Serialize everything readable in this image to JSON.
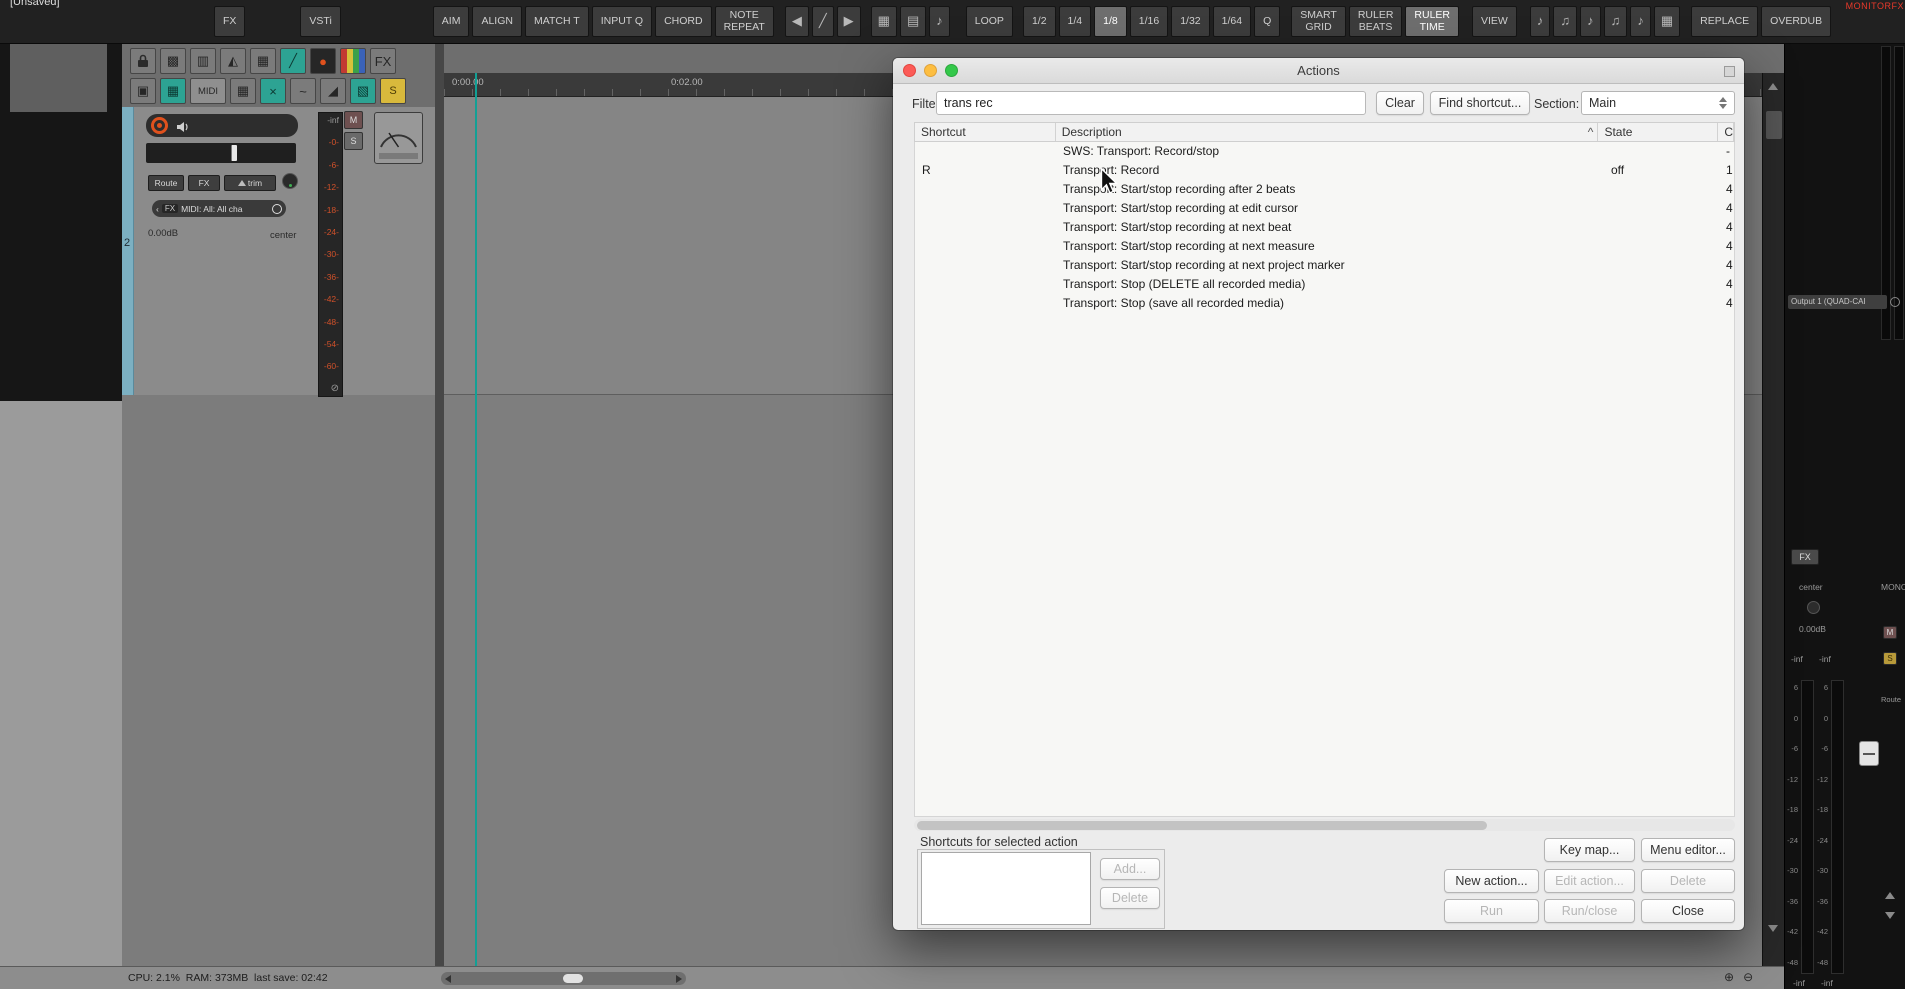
{
  "app": {
    "unsaved": "[Unsaved]",
    "monitor_fx": "MONITORFX",
    "status": "CPU: 2.1%  RAM: 373MB  last save: 02:42"
  },
  "toolbar": {
    "fx": "FX",
    "vsti": "VSTi",
    "actions": [
      "AIM",
      "ALIGN",
      "MATCH T",
      "INPUT Q",
      "CHORD",
      "NOTE\nREPEAT"
    ],
    "loop": "LOOP",
    "divisions": [
      {
        "label": "1/2"
      },
      {
        "label": "1/4"
      },
      {
        "label": "1/8",
        "active": true
      },
      {
        "label": "1/16"
      },
      {
        "label": "1/32"
      },
      {
        "label": "1/64"
      }
    ],
    "quantize": "Q",
    "ruler_modes": [
      {
        "label": "SMART\nGRID"
      },
      {
        "label": "RULER\nBEATS"
      },
      {
        "label": "RULER\nTIME",
        "active": true
      }
    ],
    "view": "VIEW",
    "replace": "REPLACE",
    "overdub": "OVERDUB"
  },
  "icons": {
    "transport": [
      {
        "name": "prev-marker-icon",
        "glyph": "◀"
      },
      {
        "name": "pencil-edit-icon",
        "glyph": "╱"
      },
      {
        "name": "play-icon",
        "glyph": "▶"
      }
    ],
    "grid_toggles": [
      {
        "name": "grid-lines-icon",
        "glyph": "▦"
      },
      {
        "name": "grid-frame-icon",
        "glyph": "▤"
      },
      {
        "name": "note-source-icon",
        "glyph": "♪"
      }
    ],
    "midi_tools": [
      {
        "name": "midi-tool-icon",
        "glyph": "♪"
      },
      {
        "name": "midi-tool-icon",
        "glyph": "♫"
      },
      {
        "name": "midi-tool-icon",
        "glyph": "♪"
      },
      {
        "name": "midi-tool-icon",
        "glyph": "♫"
      },
      {
        "name": "midi-tool-icon",
        "glyph": "♪"
      },
      {
        "name": "midi-tool-icon",
        "glyph": "▦"
      }
    ],
    "left_row1": [
      {
        "name": "grid-dots-icon",
        "glyph": "▩"
      },
      {
        "name": "routing-matrix-icon",
        "glyph": "▥"
      },
      {
        "name": "metronome-icon",
        "glyph": "◭"
      },
      {
        "name": "grid-icon",
        "glyph": "▦"
      },
      {
        "name": "draw-mode-icon",
        "glyph": "╱",
        "style": "teal"
      },
      {
        "name": "record-mode-icon",
        "glyph": "●",
        "style": "dark"
      },
      {
        "name": "theme-color-icon",
        "glyph": "▮",
        "style": "palette"
      },
      {
        "name": "fx-chain-icon",
        "glyph": "FX"
      }
    ],
    "left_row2": [
      {
        "name": "duplicate-icon",
        "glyph": "▣"
      },
      {
        "name": "item-lane-icon",
        "glyph": "▦",
        "style": "teal"
      },
      {
        "name": "midi-editor-button",
        "glyph": "MIDI",
        "style": "wide"
      },
      {
        "name": "grid-settings-icon",
        "glyph": "▦"
      },
      {
        "name": "erase-icon",
        "glyph": "×",
        "style": "teal"
      },
      {
        "name": "envelope-icon",
        "glyph": "~"
      },
      {
        "name": "crossfade-icon",
        "glyph": "◢"
      },
      {
        "name": "select-tool-icon",
        "glyph": "▧",
        "style": "teal"
      },
      {
        "name": "snap-button",
        "glyph": "S",
        "style": "yellow"
      }
    ],
    "zoom": [
      {
        "name": "zoom-in-icon",
        "glyph": "⊕"
      },
      {
        "name": "zoom-out-icon",
        "glyph": "⊖"
      }
    ],
    "chevron_left": "‹"
  },
  "track": {
    "number": "2",
    "route": "Route",
    "fx": "FX",
    "trim": "trim",
    "io_fx": "FX",
    "io_label": "MIDI: All: All cha",
    "volume": "0.00dB",
    "pan": "center",
    "mute": "M",
    "solo": "S",
    "null_sign": "⊘",
    "meter_scale": [
      "-inf",
      "-0-",
      "-6-",
      "-12-",
      "-18-",
      "-24-",
      "-30-",
      "-36-",
      "-42-",
      "-48-",
      "-54-",
      "-60-"
    ]
  },
  "ruler": {
    "time_labels": [
      "0:00.00",
      "0:02.00"
    ]
  },
  "dialog": {
    "title": "Actions",
    "filter_label": "Filter",
    "filter_value": "trans rec",
    "clear": "Clear",
    "find_shortcut": "Find shortcut...",
    "section_label": "Section:",
    "section_value": "Main",
    "col_shortcut": "Shortcut",
    "col_description": "Description",
    "col_state": "State",
    "col_count": "C",
    "sort_indicator": "^",
    "rows": [
      {
        "shortcut": "",
        "description": "SWS: Transport: Record/stop",
        "state": "",
        "count": "-"
      },
      {
        "shortcut": "R",
        "description": "Transport: Record",
        "state": "off",
        "count": "1"
      },
      {
        "shortcut": "",
        "description": "Transport: Start/stop recording after 2 beats",
        "state": "",
        "count": "4"
      },
      {
        "shortcut": "",
        "description": "Transport: Start/stop recording at edit cursor",
        "state": "",
        "count": "4"
      },
      {
        "shortcut": "",
        "description": "Transport: Start/stop recording at next beat",
        "state": "",
        "count": "4"
      },
      {
        "shortcut": "",
        "description": "Transport: Start/stop recording at next measure",
        "state": "",
        "count": "4"
      },
      {
        "shortcut": "",
        "description": "Transport: Start/stop recording at next project marker",
        "state": "",
        "count": "4"
      },
      {
        "shortcut": "",
        "description": "Transport: Stop (DELETE all recorded media)",
        "state": "",
        "count": "4"
      },
      {
        "shortcut": "",
        "description": "Transport: Stop (save all recorded media)",
        "state": "",
        "count": "4"
      }
    ],
    "shortcuts_label": "Shortcuts for selected action",
    "add": "Add...",
    "delete_shortcut": "Delete",
    "key_map": "Key map...",
    "menu_editor": "Menu editor...",
    "new_action": "New action...",
    "edit_action": "Edit action...",
    "delete_action": "Delete",
    "run": "Run",
    "run_close": "Run/close",
    "close": "Close"
  },
  "mixer": {
    "output": "Output 1 (QUAD-CAI",
    "fx": "FX",
    "pan": "center",
    "mono": "MONO",
    "volume": "0.00dB",
    "peaks": [
      "-inf",
      "-inf"
    ],
    "mute": "M",
    "solo": "S",
    "route": "Route",
    "scale": [
      "6",
      "0",
      "-6",
      "-12",
      "-18",
      "-24",
      "-30",
      "-36",
      "-42",
      "-48"
    ],
    "bottom_peaks": [
      "-inf",
      "-inf"
    ]
  }
}
